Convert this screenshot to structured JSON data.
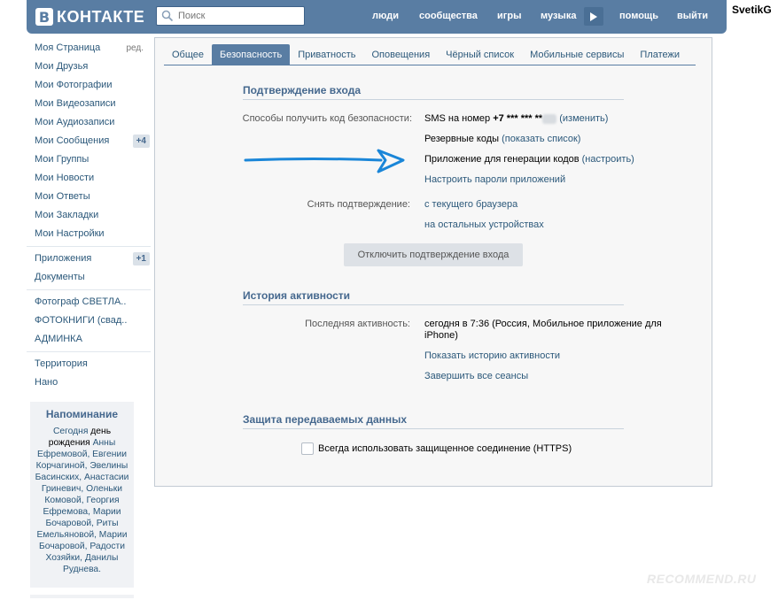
{
  "header": {
    "logo_letter": "В",
    "logo_text": "КОНТАКТЕ",
    "search_placeholder": "Поиск",
    "nav": [
      "люди",
      "сообщества",
      "игры",
      "музыка",
      "помощь",
      "выйти"
    ],
    "username": "SvetikG"
  },
  "sidebar": {
    "group1": [
      {
        "label": "Моя Страница",
        "extra": "ред."
      },
      {
        "label": "Мои Друзья"
      },
      {
        "label": "Мои Фотографии"
      },
      {
        "label": "Мои Видеозаписи"
      },
      {
        "label": "Мои Аудиозаписи"
      },
      {
        "label": "Мои Сообщения",
        "badge": "+4"
      },
      {
        "label": "Мои Группы"
      },
      {
        "label": "Мои Новости"
      },
      {
        "label": "Мои Ответы"
      },
      {
        "label": "Мои Закладки"
      },
      {
        "label": "Мои Настройки"
      }
    ],
    "group2": [
      {
        "label": "Приложения",
        "badge": "+1"
      },
      {
        "label": "Документы"
      }
    ],
    "group3": [
      {
        "label": "Фотограф СВЕТЛА.."
      },
      {
        "label": "ФОТОКНИГИ (свад.."
      },
      {
        "label": "АДМИНКА"
      }
    ],
    "group4": [
      {
        "label": "Территория"
      },
      {
        "label": "Нано"
      }
    ]
  },
  "reminder": {
    "title": "Напоминание",
    "today": "Сегодня",
    "text_a": " день рождения ",
    "people": "Анны Ефремовой, Евгении Корчагиной, Эвелины Басинских, Анастасии Гриневич, Оленьки Комовой, Георгия Ефремова, Марии Бочаровой, Риты Емельяновой, Марии Бочаровой, Радости Хозяйки, Данилы Руднева."
  },
  "tabs": [
    "Общее",
    "Безопасность",
    "Приватность",
    "Оповещения",
    "Чёрный список",
    "Мобильные сервисы",
    "Платежи"
  ],
  "login_confirm": {
    "title": "Подтверждение входа",
    "methods_label": "Способы получить код безопасности:",
    "sms_prefix": "SMS на номер ",
    "sms_number": "+7 *** *** **",
    "sms_change": "(изменить)",
    "backup_codes": "Резервные коды",
    "backup_show": "(показать список)",
    "app_gen": "Приложение для генерации кодов",
    "app_setup": "(настроить)",
    "app_passwords": "Настроить пароли приложений",
    "remove_label": "Снять подтверждение:",
    "remove_browser": "с текущего браузера",
    "remove_other": "на остальных устройствах",
    "disable_button": "Отключить подтверждение входа"
  },
  "activity": {
    "title": "История активности",
    "last_label": "Последняя активность:",
    "last_value": "сегодня в 7:36 (Россия, Мобильное приложение для iPhone)",
    "show_history": "Показать историю активности",
    "end_sessions": "Завершить все сеансы"
  },
  "protection": {
    "title": "Защита передаваемых данных",
    "https_label": "Всегда использовать защищенное соединение (HTTPS)",
    "https_checked": false
  },
  "watermark": "RECOMMEND.RU",
  "colors": {
    "header_bg": "#597da3",
    "link": "#2b587a",
    "arrow": "#1a86d8"
  }
}
